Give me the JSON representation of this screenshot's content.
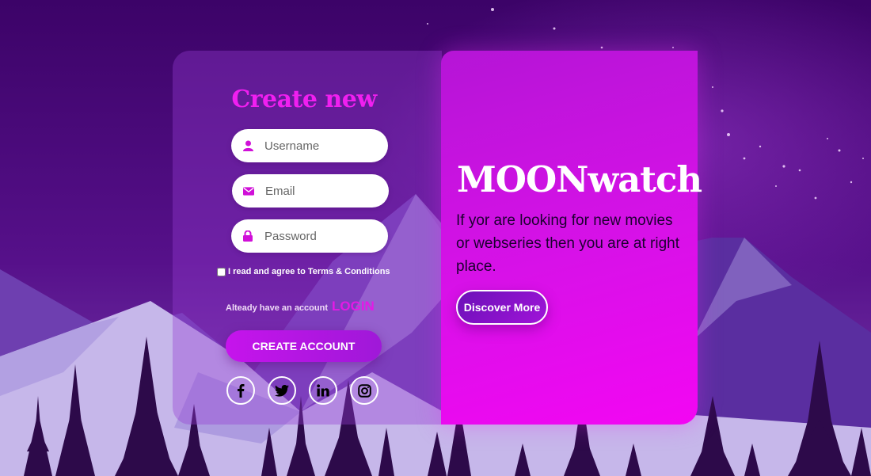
{
  "form": {
    "title": "Create new",
    "username_placeholder": "Username",
    "email_placeholder": "Email",
    "password_placeholder": "Password",
    "terms_label": "I read and agree to Terms & Conditions",
    "terms_checked": false,
    "already_text": "Alteady have an account",
    "login_link": "LOGIN",
    "create_button": "CREATE ACCOUNT",
    "social_icons": [
      "facebook-icon",
      "twitter-icon",
      "linkedin-icon",
      "instagram-icon"
    ]
  },
  "promo": {
    "brand": "MOONwatch",
    "description": "If yor are looking for new movies or webseries then you are at right place.",
    "discover_button": "Discover More"
  },
  "colors": {
    "accent": "#e419e6",
    "panel_gradient_start": "#b515d6",
    "panel_gradient_end": "#f306f3",
    "background": "#4a0a7a"
  }
}
